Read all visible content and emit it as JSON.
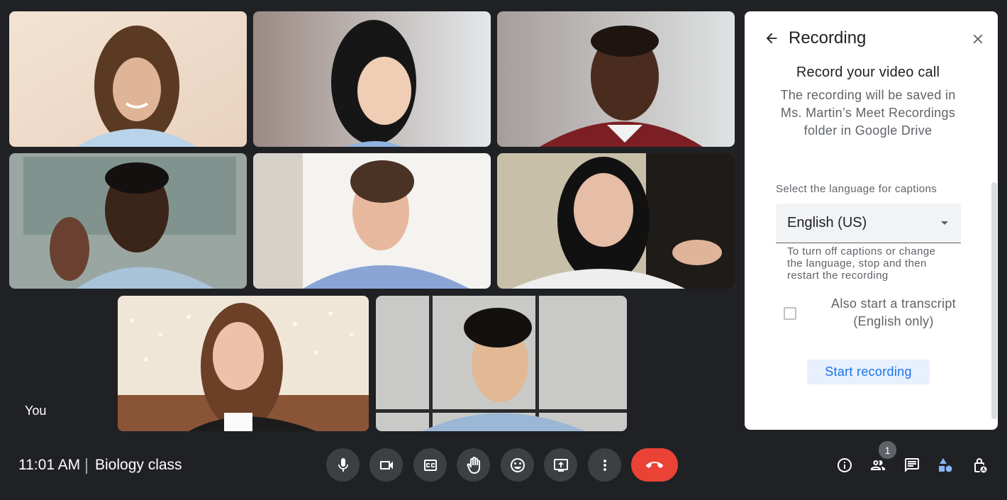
{
  "meeting": {
    "time": "11:01 AM",
    "name": "Biology class",
    "self_label": "You"
  },
  "participants": [
    {
      "tile": 1,
      "description": "Woman with curly brown hair, light blue shirt, beige background"
    },
    {
      "tile": 2,
      "description": "Woman with dark shoulder-length hair, blurred grey background"
    },
    {
      "tile": 3,
      "description": "Young man in maroon shirt, blurred grey background"
    },
    {
      "tile": 4,
      "description": "Young man waving, light denim shirt, cafe background"
    },
    {
      "tile": 5,
      "description": "Teen boy in blue shirt, bright window background"
    },
    {
      "tile": 6,
      "description": "Woman with long dark hair, white top, earphones"
    },
    {
      "tile": 7,
      "description": "Woman with long wavy hair, black jacket, string lights"
    },
    {
      "tile": 8,
      "description": "Young man with curly black hair, denim shirt"
    }
  ],
  "panel": {
    "title": "Recording",
    "back_icon": "arrow-back-icon",
    "close_icon": "close-icon",
    "heading": "Record your video call",
    "description": "The recording will be saved in Ms. Martin’s Meet Recordings folder in Google Drive",
    "caption_label": "Select the language for captions",
    "caption_language": "English (US)",
    "caption_help": "To turn off captions or change the language, stop and then restart the recording",
    "transcript_label": "Also start a transcript (English only)",
    "transcript_checked": false,
    "start_button": "Start recording"
  },
  "controls": [
    {
      "name": "microphone",
      "icon": "mic-icon"
    },
    {
      "name": "camera",
      "icon": "videocam-icon"
    },
    {
      "name": "captions",
      "icon": "closed-caption-icon"
    },
    {
      "name": "raise-hand",
      "icon": "hand-icon"
    },
    {
      "name": "reactions",
      "icon": "emoji-icon"
    },
    {
      "name": "present",
      "icon": "present-screen-icon"
    },
    {
      "name": "more-options",
      "icon": "more-vert-icon"
    },
    {
      "name": "leave-call",
      "icon": "call-end-icon"
    }
  ],
  "right_controls": [
    {
      "name": "meeting-details",
      "icon": "info-icon"
    },
    {
      "name": "people",
      "icon": "people-icon",
      "badge": "1"
    },
    {
      "name": "chat",
      "icon": "chat-icon"
    },
    {
      "name": "activities",
      "icon": "shapes-icon"
    },
    {
      "name": "host-controls",
      "icon": "lock-person-icon"
    }
  ],
  "colors": {
    "background": "#202124",
    "control_button": "#3c4043",
    "end_call": "#ea4335",
    "primary_blue": "#1a73e8",
    "activities_accent": "#8ab4f8"
  }
}
